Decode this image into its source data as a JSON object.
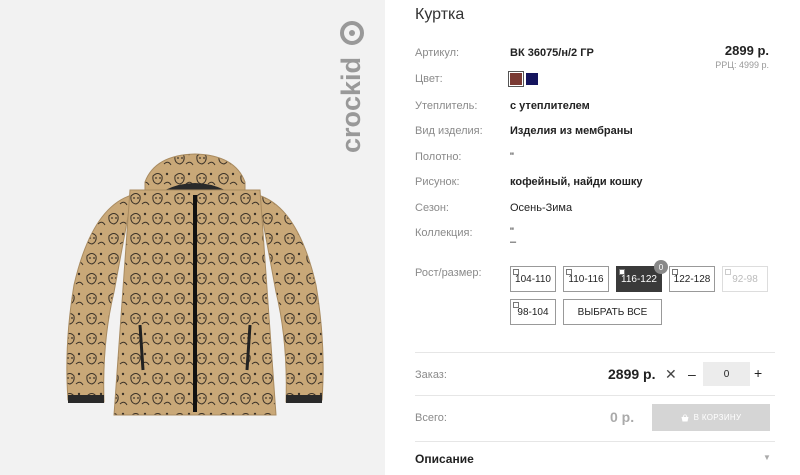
{
  "brand": {
    "logo_text": "crockid"
  },
  "product": {
    "title": "Куртка",
    "price": "2899 р.",
    "rrp": "РРЦ: 4999 р."
  },
  "attributes": [
    {
      "label": "Артикул:",
      "value": "ВК 36075/н/2 ГР"
    },
    {
      "label": "Цвет:",
      "value": ""
    },
    {
      "label": "Утеплитель:",
      "value": "с утеплителем"
    },
    {
      "label": "Вид изделия:",
      "value": "Изделия из мембраны"
    },
    {
      "label": "Полотно:",
      "value": "\""
    },
    {
      "label": "Рисунок:",
      "value": "кофейный, найди кошку"
    },
    {
      "label": "Сезон:",
      "value": "Осень-Зима"
    },
    {
      "label": "Коллекция:",
      "value": "\"",
      "value2": "–"
    },
    {
      "label": "Рост/размер:",
      "value": ""
    }
  ],
  "colors": [
    {
      "name": "brown",
      "hex": "#7a3a33",
      "selected": true
    },
    {
      "name": "navy",
      "hex": "#15155e",
      "selected": false
    }
  ],
  "sizes": [
    {
      "label": "104-110",
      "state": "normal"
    },
    {
      "label": "110-116",
      "state": "normal"
    },
    {
      "label": "116-122",
      "state": "active",
      "badge": "0"
    },
    {
      "label": "122-128",
      "state": "normal"
    },
    {
      "label": "92-98",
      "state": "disabled"
    },
    {
      "label": "98-104",
      "state": "normal"
    }
  ],
  "select_all_label": "ВЫБРАТЬ ВСЕ",
  "order": {
    "label": "Заказ:",
    "price": "2899 р.",
    "times": "✕",
    "minus": "–",
    "quantity": "0",
    "plus": "+"
  },
  "total": {
    "label": "Всего:",
    "sum": "0 р.",
    "cart_button": "В КОРЗИНУ",
    "cart_icon": "basket-icon"
  },
  "description": {
    "title": "Описание",
    "toggle_icon": "triangle-down-icon"
  }
}
